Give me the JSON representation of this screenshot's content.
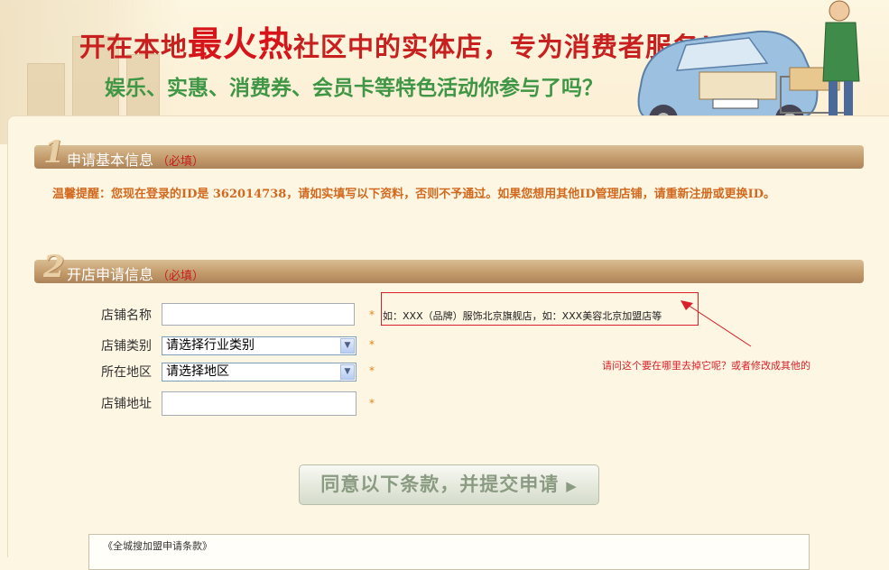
{
  "banner": {
    "headline_part1": "开在本地",
    "headline_hot": "最火热",
    "headline_part2": "社区中的实体店，专为消费者服务！",
    "subline": "娱乐、实惠、消费券、会员卡等特色活动你参与了吗？"
  },
  "section1": {
    "number": "1",
    "title": "申请基本信息",
    "required": "（必填）"
  },
  "notice": {
    "text": "温馨提醒：您现在登录的ID是 362014738，请如实填写以下资料，否则不予通过。如果您想用其他ID管理店铺，请重新注册或更换ID。"
  },
  "section2": {
    "number": "2",
    "title": "开店申请信息",
    "required": "（必填）"
  },
  "form": {
    "store_name_label": "店铺名称",
    "store_name_value": "",
    "store_category_label": "店铺类别",
    "store_category_selected": "请选择行业类别",
    "region_label": "所在地区",
    "region_selected": "请选择地区",
    "store_address_label": "店铺地址",
    "store_address_value": "",
    "required_mark": "*",
    "hint": "如：XXX（品牌）服饰北京旗舰店，如：XXX美容北京加盟店等"
  },
  "annotation": {
    "text": "请问这个要在哪里去掉它呢？或者修改成其他的"
  },
  "submit": {
    "label": "同意以下条款，并提交申请",
    "arrow": "▶"
  },
  "terms": {
    "title": "《全城搜加盟申请条款》"
  },
  "colors": {
    "accent_red": "#c7201f",
    "section_bar": "#c39b6b",
    "notice_orange": "#d2691e",
    "subline_green": "#3f9645"
  }
}
